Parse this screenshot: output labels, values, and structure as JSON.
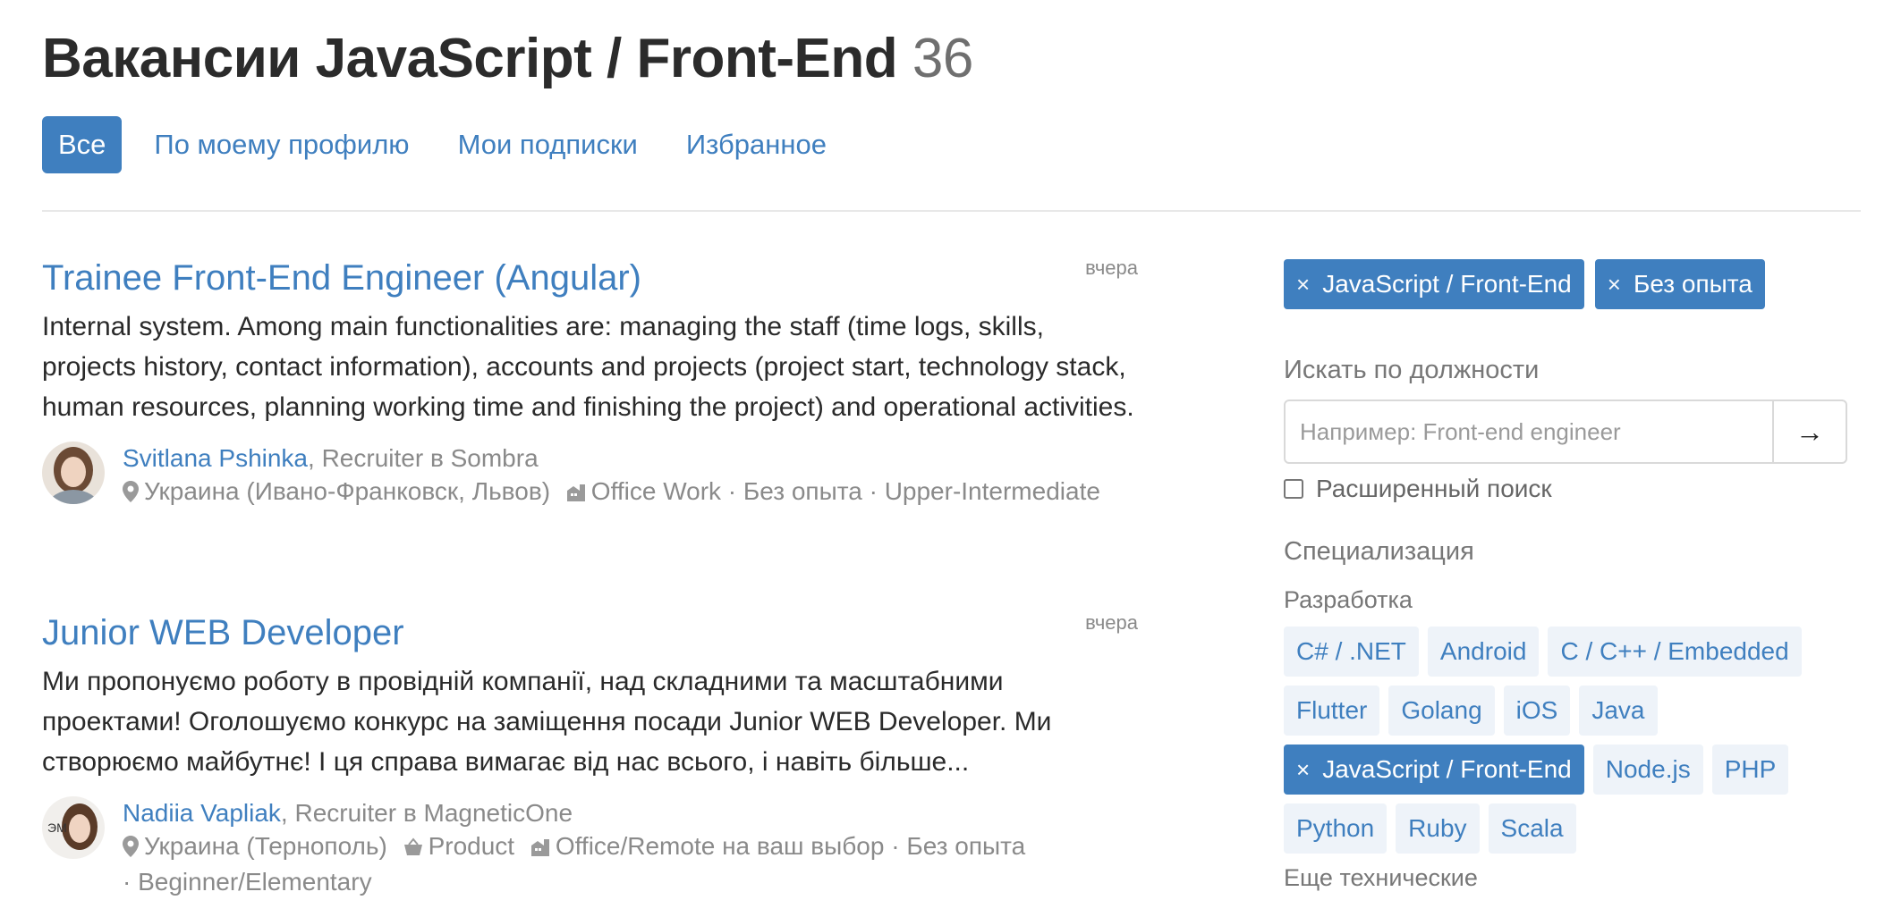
{
  "header": {
    "title": "Вакансии JavaScript / Front-End",
    "count": "36"
  },
  "tabs": [
    {
      "label": "Все",
      "active": true
    },
    {
      "label": "По моему профилю",
      "active": false
    },
    {
      "label": "Мои подписки",
      "active": false
    },
    {
      "label": "Избранное",
      "active": false
    }
  ],
  "vacancies": [
    {
      "title": "Trainee Front-End Engineer (Angular)",
      "date": "вчера",
      "description": "Internal system. Among main functionalities are: managing the staff (time logs, skills, projects history, contact information), accounts and projects (project start, technology stack, human resources, planning working time and finishing the project) and operational activities.",
      "recruiter_name": "Svitlana Pshinka",
      "recruiter_role": ", Recruiter в Sombra",
      "location": "Украина (Ивано-Франковск, Львов)",
      "work_type": "Office Work",
      "details": " · Без опыта · Upper-Intermediate"
    },
    {
      "title": "Junior WEB Developer",
      "date": "вчера",
      "description": "Ми пропонуємо роботу в провідній компанії, над складними та масштабними проектами! Оголошуємо конкурс на заміщення посади Junior WEB Developer. Ми створюємо майбутнє! І ця справа вимагає від нас всього, і навіть більше...",
      "recruiter_name": "Nadiia Vapliak",
      "recruiter_role": ", Recruiter в MagneticOne",
      "location": "Украина (Тернополь)",
      "company_type": "Product",
      "work_type": "Office/Remote на ваш выбор",
      "details": " · Без опыта",
      "details2": "· Beginner/Elementary",
      "avatar_text": "ЭМ"
    }
  ],
  "sidebar": {
    "active_filters": [
      "JavaScript / Front-End",
      "Без опыта"
    ],
    "search_label": "Искать по должности",
    "search_placeholder": "Например: Front-end engineer",
    "search_button": "→",
    "advanced_label": "Расширенный поиск",
    "specialization_label": "Специализация",
    "dev_label": "Разработка",
    "dev_tags": [
      {
        "label": "C# / .NET",
        "selected": false
      },
      {
        "label": "Android",
        "selected": false
      },
      {
        "label": "C / C++ / Embedded",
        "selected": false
      },
      {
        "label": "Flutter",
        "selected": false
      },
      {
        "label": "Golang",
        "selected": false
      },
      {
        "label": "iOS",
        "selected": false
      },
      {
        "label": "Java",
        "selected": false
      },
      {
        "label": "JavaScript / Front-End",
        "selected": true
      },
      {
        "label": "Node.js",
        "selected": false
      },
      {
        "label": "PHP",
        "selected": false
      },
      {
        "label": "Python",
        "selected": false
      },
      {
        "label": "Ruby",
        "selected": false
      },
      {
        "label": "Scala",
        "selected": false
      }
    ],
    "more_label": "Еще технические",
    "remove_symbol": "×"
  },
  "colors": {
    "accent": "#3f7fbf",
    "tag_bg": "#eef3f9"
  }
}
